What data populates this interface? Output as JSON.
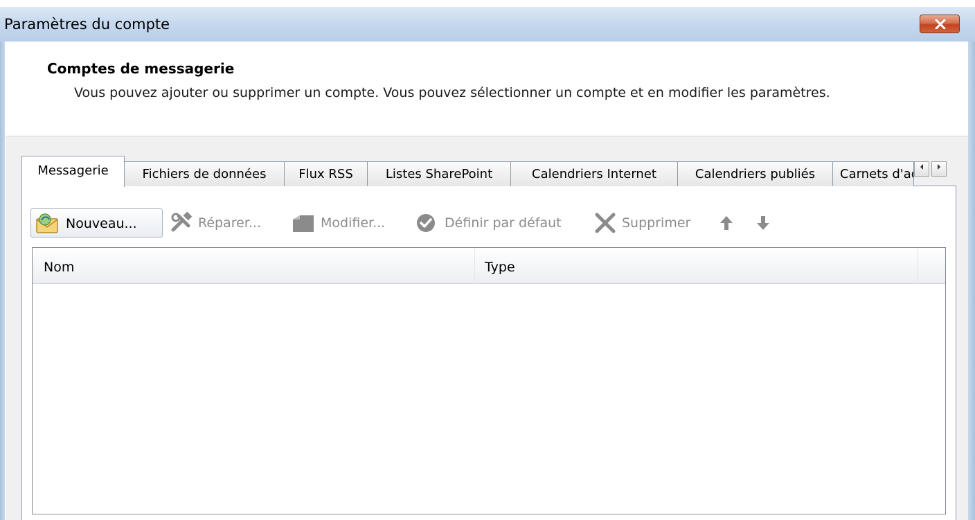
{
  "window": {
    "title": "Paramètres du compte",
    "close_label": "Fermer"
  },
  "header": {
    "section_title": "Comptes de messagerie",
    "description": "Vous pouvez ajouter ou supprimer un compte. Vous pouvez sélectionner un compte et en modifier les paramètres."
  },
  "tabs": [
    {
      "label": "Messagerie",
      "active": true
    },
    {
      "label": "Fichiers de données",
      "active": false
    },
    {
      "label": "Flux RSS",
      "active": false
    },
    {
      "label": "Listes SharePoint",
      "active": false
    },
    {
      "label": "Calendriers Internet",
      "active": false
    },
    {
      "label": "Calendriers publiés",
      "active": false
    },
    {
      "label": "Carnets d'adresses",
      "active": false
    }
  ],
  "toolbar": {
    "new_label": "Nouveau...",
    "repair_label": "Réparer...",
    "modify_label": "Modifier...",
    "set_default_label": "Définir par défaut",
    "delete_label": "Supprimer"
  },
  "list": {
    "columns": [
      "Nom",
      "Type"
    ],
    "rows": []
  },
  "icons": {
    "new": "envelope-new-icon",
    "repair": "tools-icon",
    "modify": "edit-icon",
    "set_default": "checkmark-circle-icon",
    "delete": "x-icon",
    "move_up": "arrow-up-icon",
    "move_down": "arrow-down-icon",
    "scroll_left": "scroll-left-icon",
    "scroll_right": "scroll-right-icon"
  },
  "colors": {
    "titlebar": "#c6d8ee",
    "close_button": "#c2441f",
    "disabled_text": "#8b8b8b"
  }
}
